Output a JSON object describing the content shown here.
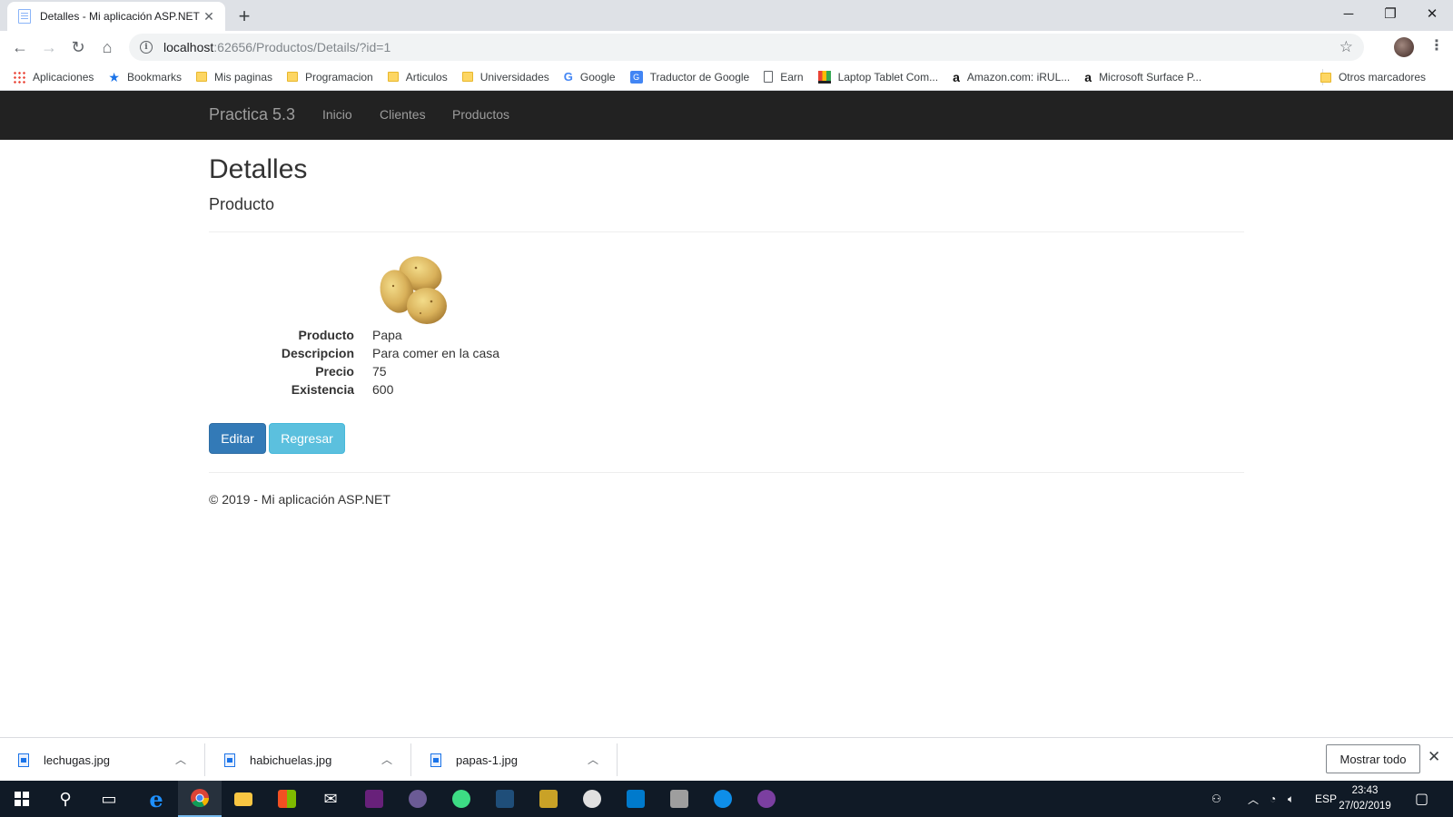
{
  "browser": {
    "tab_title": "Detalles - Mi aplicación ASP.NET",
    "url_host": "localhost",
    "url_rest": ":62656/Productos/Details/?id=1",
    "bookmarks": [
      {
        "label": "Aplicaciones",
        "icon": "apps-grid-icon"
      },
      {
        "label": "Bookmarks",
        "icon": "star-icon"
      },
      {
        "label": "Mis paginas",
        "icon": "folder-icon"
      },
      {
        "label": "Programacion",
        "icon": "folder-icon"
      },
      {
        "label": "Articulos",
        "icon": "folder-icon"
      },
      {
        "label": "Universidades",
        "icon": "folder-icon"
      },
      {
        "label": "Google",
        "icon": "google-icon"
      },
      {
        "label": "Traductor de Google",
        "icon": "translate-icon"
      },
      {
        "label": "Earn",
        "icon": "page-icon"
      },
      {
        "label": "Laptop Tablet Com...",
        "icon": "laptop-icon"
      },
      {
        "label": "Amazon.com: iRUL...",
        "icon": "amazon-icon"
      },
      {
        "label": "Microsoft Surface P...",
        "icon": "amazon-icon"
      }
    ],
    "other_bookmarks": "Otros marcadores"
  },
  "app": {
    "brand": "Practica 5.3",
    "nav": [
      "Inicio",
      "Clientes",
      "Productos"
    ]
  },
  "main": {
    "title": "Detalles",
    "subtitle": "Producto",
    "fields": [
      {
        "label": "Producto",
        "value": "Papa"
      },
      {
        "label": "Descripcion",
        "value": "Para comer en la casa"
      },
      {
        "label": "Precio",
        "value": "75"
      },
      {
        "label": "Existencia",
        "value": "600"
      }
    ],
    "edit_button": "Editar",
    "back_button": "Regresar",
    "footer": "© 2019 - Mi aplicación ASP.NET"
  },
  "downloads": {
    "files": [
      "lechugas.jpg",
      "habichuelas.jpg",
      "papas-1.jpg"
    ],
    "show_all": "Mostrar todo"
  },
  "taskbar": {
    "language": "ESP",
    "time": "23:43",
    "date": "27/02/2019"
  },
  "colors": {
    "navbar": "#222222",
    "primary": "#337ab7",
    "info": "#5bc0de",
    "taskbar": "#101a26"
  }
}
